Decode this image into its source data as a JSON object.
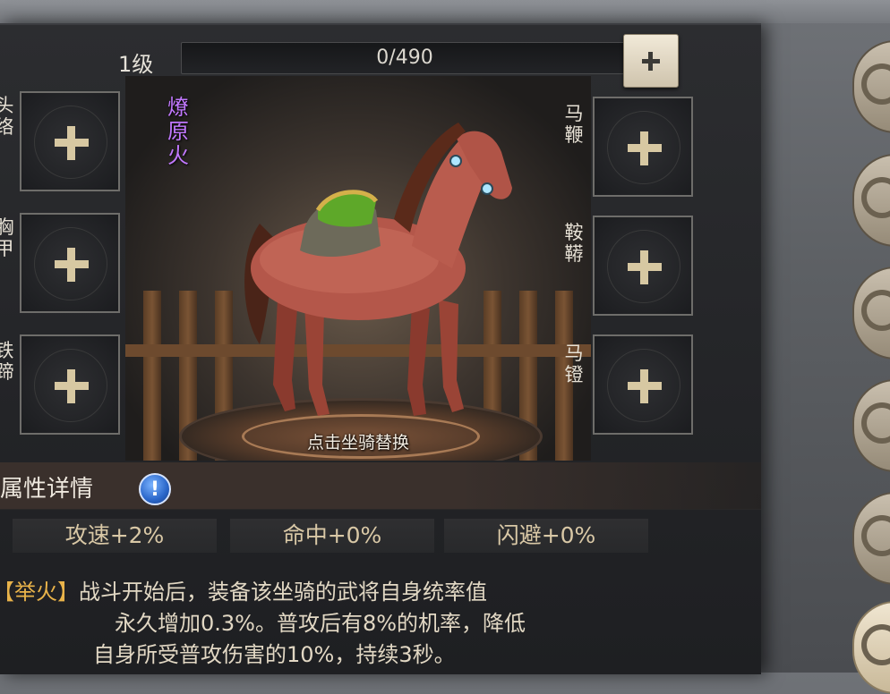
{
  "header": {
    "level_label": "1级",
    "exp_text": "0/490",
    "add_exp_icon": "plus-icon"
  },
  "mount": {
    "name": "燎原火",
    "name_color": "#c178ff",
    "replace_hint": "点击坐骑替换"
  },
  "equipment": {
    "left": [
      {
        "label": "头络"
      },
      {
        "label": "胸甲"
      },
      {
        "label": "铁蹄"
      }
    ],
    "right": [
      {
        "label": "马鞭"
      },
      {
        "label": "鞍鞯"
      },
      {
        "label": "马镫"
      }
    ],
    "slot_icon": "plus-icon"
  },
  "attributes": {
    "title": "属性详情",
    "info_icon": "info-icon",
    "stats": [
      {
        "text": "攻速+2%"
      },
      {
        "text": "命中+0%"
      },
      {
        "text": "闪避+0%"
      }
    ]
  },
  "skill": {
    "name": "【举火】",
    "line1": "战斗开始后，装备该坐骑的武将自身统率值",
    "line2": "永久增加0.3%。普攻后有8%的机率，降低",
    "line3": "自身所受普攻伤害的10%，持续3秒。"
  },
  "sidebar": {
    "icon": "swirl-icon",
    "tabs": 6
  },
  "colors": {
    "skill_name": "#e9b34a",
    "stat_text": "#d9c8a6",
    "mount_name": "#c178ff"
  }
}
